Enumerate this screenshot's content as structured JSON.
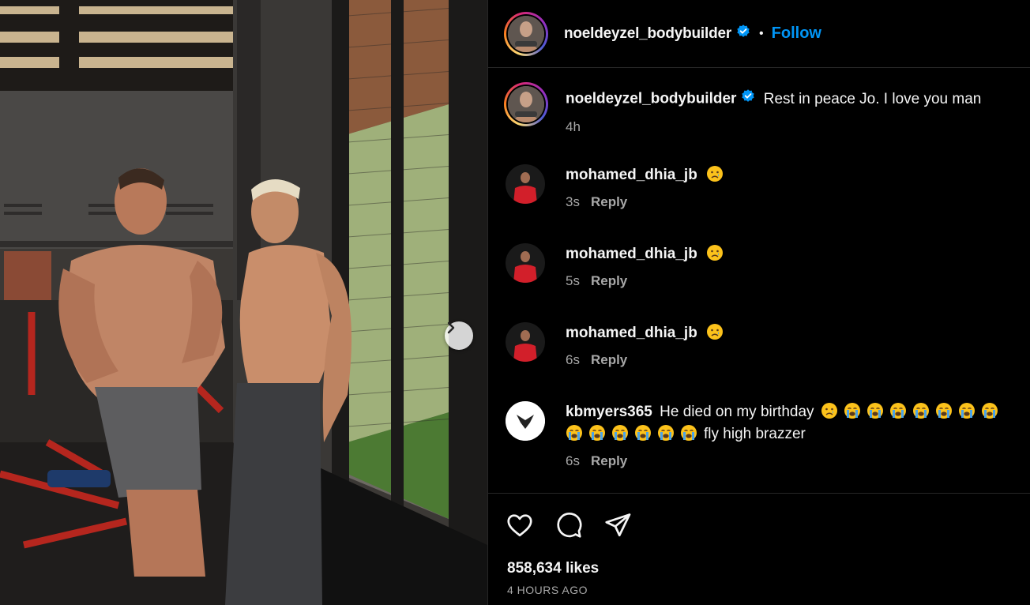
{
  "post": {
    "author": "noeldeyzel_bodybuilder",
    "follow_label": "Follow",
    "separator": "•",
    "caption": "Rest in peace Jo. I love you man",
    "caption_age": "4h",
    "likes": "858,634 likes",
    "time_ago": "4 HOURS AGO"
  },
  "comments": [
    {
      "user": "mohamed_dhia_jb",
      "text": "",
      "emojis": [
        "sad-face"
      ],
      "age": "3s",
      "reply": "Reply"
    },
    {
      "user": "mohamed_dhia_jb",
      "text": "",
      "emojis": [
        "sad-face"
      ],
      "age": "5s",
      "reply": "Reply"
    },
    {
      "user": "mohamed_dhia_jb",
      "text": "",
      "emojis": [
        "sad-face"
      ],
      "age": "6s",
      "reply": "Reply"
    },
    {
      "user": "kbmyers365",
      "text_line1": "He died on my birthday",
      "text_line2": "fly high brazzer",
      "emojis_line1": [
        "sad-face",
        "crying-face",
        "crying-face",
        "crying-face",
        "crying-face",
        "crying-face",
        "crying-face",
        "crying-face"
      ],
      "emojis_line2": [
        "crying-face",
        "crying-face",
        "crying-face",
        "crying-face",
        "crying-face",
        "crying-face"
      ],
      "age": "6s",
      "reply": "Reply"
    }
  ],
  "icons": {
    "verified": "verified-badge-icon",
    "next": "chevron-right-icon",
    "like": "heart-icon",
    "comment": "comment-bubble-icon",
    "share": "paper-plane-icon"
  },
  "colors": {
    "background": "#000000",
    "text": "#f5f5f5",
    "muted": "#a8a8a8",
    "link": "#0095f6",
    "verified": "#0095f6",
    "divider": "#262626"
  }
}
